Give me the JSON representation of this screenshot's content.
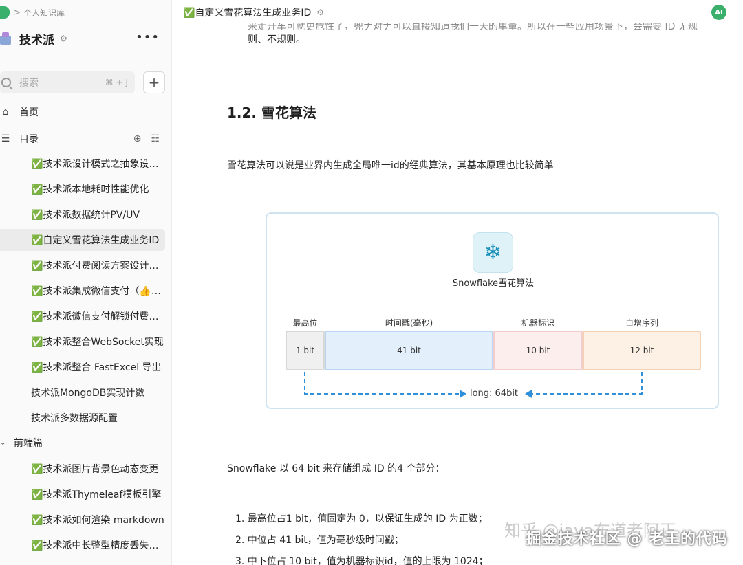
{
  "breadcrumb": {
    "separator": ">",
    "label": "个人知识库"
  },
  "knowledge_base": {
    "name": "技术派",
    "more": "•••"
  },
  "search": {
    "placeholder": "搜索",
    "shortcut": "⌘ + J"
  },
  "add_button": "+",
  "nav": {
    "home": "首页",
    "toc": "目录"
  },
  "tree": {
    "items": [
      "✅技术派设计模式之抽象设计模式",
      "✅技术派本地耗时性能优化",
      "✅技术派数据统计PV/UV",
      "✅自定义雪花算法生成业务ID",
      "✅技术派付费阅读方案设计与实现",
      "✅技术派集成微信支付（👍推荐）",
      "✅技术派微信支付解锁付费阅读",
      "✅技术派整合WebSocket实现",
      "✅技术派整合 FastExcel 导出",
      "技术派MongoDB实现计数",
      "技术派多数据源配置"
    ],
    "group": "前端篇",
    "group_items": [
      "✅技术派图片背景色动态变更",
      "✅技术派Thymeleaf模板引擎",
      "✅技术派如何渲染 markdown",
      "✅技术派中长整型精度丢失问题"
    ]
  },
  "header": {
    "doc_title": "✅自定义雪花算法生成业务ID",
    "ai_label": "AI"
  },
  "content": {
    "top_line_faded": "来走升车可就更危性了，兜ナ对ナ可以直接知道我们一天的单量。所以在一些应用场景下，会需要 ID 无规",
    "top_line": "则、不规则。",
    "heading": "1.2. 雪花算法",
    "intro": "雪花算法可以说是业界内生成全局唯一id的经典算法，其基本原理也比较简单",
    "diagram": {
      "title": "Snowflake雪花算法",
      "segments": [
        {
          "label": "最高位",
          "value": "1 bit"
        },
        {
          "label": "时间戳(毫秒)",
          "value": "41 bit"
        },
        {
          "label": "机器标识",
          "value": "10 bit"
        },
        {
          "label": "自增序列",
          "value": "12 bit"
        }
      ],
      "total": "long: 64bit"
    },
    "summary": "Snowflake 以 64 bit 来存储组成 ID 的4 个部分：",
    "list": [
      "1. 最高位占1 bit，值固定为 0，以保证生成的 ID 为正数；",
      "2. 中位占 41 bit，值为毫秒级时间戳；",
      "3. 中下位占 10 bit，值为机器标识id，值的上限为 1024；"
    ]
  },
  "watermarks": {
    "zhihu": "知乎 @java布道者阿正",
    "juejin": "掘金技术社区 @ 老王的代码"
  }
}
